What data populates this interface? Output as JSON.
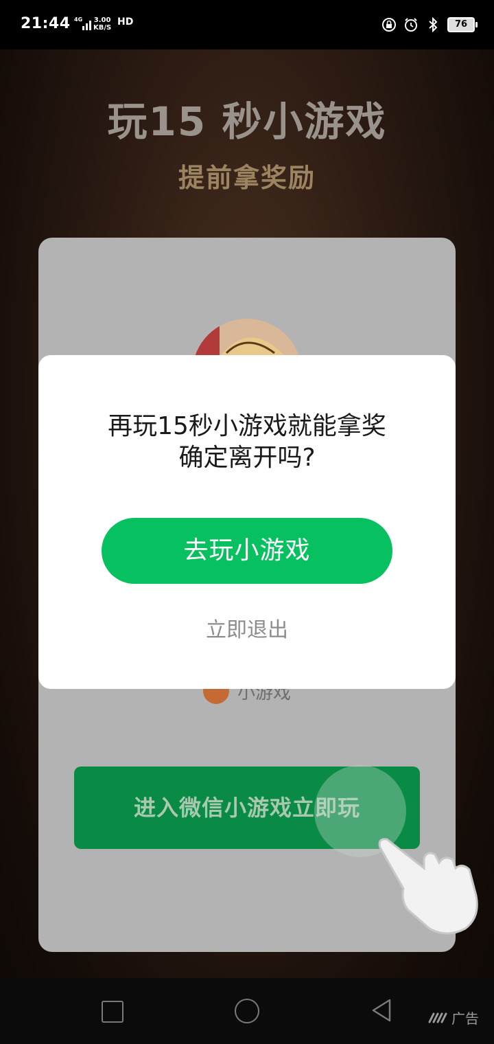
{
  "status_bar": {
    "time": "21:44",
    "speed_value": "3.00",
    "speed_unit": "KB/S",
    "hd_label": "HD",
    "battery": "76",
    "icons": [
      "network-4g-icon",
      "signal-icon",
      "call-hd-icon",
      "lock-rotation-icon",
      "alarm-icon",
      "bluetooth-icon",
      "battery-icon"
    ]
  },
  "header": {
    "title": "玩15 秒小游戏",
    "subtitle": "提前拿奖励"
  },
  "background_card": {
    "game_label": "小游戏",
    "enter_button_label": "进入微信小游戏立即玩"
  },
  "dialog": {
    "message_line1": "再玩15秒小游戏就能拿奖",
    "message_line2": "确定离开吗?",
    "primary_button": "去玩小游戏",
    "secondary_link": "立即退出"
  },
  "nav_bar": {
    "ad_label": "广告"
  },
  "colors": {
    "primary_green": "#07c160",
    "card_button_green": "#098a45",
    "title_gray": "#9a938c",
    "subtitle_gold": "#9c8460"
  }
}
